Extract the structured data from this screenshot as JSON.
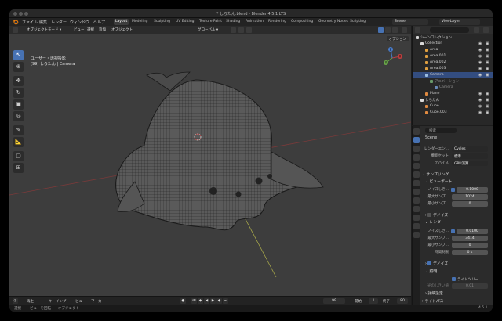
{
  "window": {
    "title": "* しろたん.blend - Blender 4.5.1 LTS"
  },
  "menubar": {
    "items": [
      "ファイル",
      "編集",
      "レンダー",
      "ウィンドウ",
      "ヘルプ"
    ],
    "workspaces": [
      "Layout",
      "Modeling",
      "Sculpting",
      "UV Editing",
      "Texture Paint",
      "Shading",
      "Animation",
      "Rendering",
      "Compositing",
      "Geometry Nodes",
      "Scripting"
    ],
    "active_workspace": "Layout",
    "scene": "Scene",
    "view_layer": "ViewLayer"
  },
  "viewport_header": {
    "mode": "オブジェクトモード",
    "menus": [
      "ビュー",
      "選択",
      "追加",
      "オブジェクト"
    ],
    "transform_orientation": "グローバル",
    "options": "オプション"
  },
  "viewport": {
    "view_name": "ユーザー・透視投影",
    "object_info": "(99) しろたん | Camera",
    "tools": [
      "select-icon",
      "cursor-icon",
      "move-icon",
      "rotate-icon",
      "scale-icon",
      "transform-icon",
      "annotate-icon",
      "measure-icon",
      "add-cube-icon",
      "camera-view-icon"
    ],
    "gizmo_labels": {
      "x": "X",
      "y": "Y",
      "z": "Z"
    }
  },
  "timeline": {
    "mode": "再生",
    "keying": "キーイング",
    "view": "ビュー",
    "marker": "マーカー",
    "current_frame": "99",
    "start_label": "開始",
    "start": "1",
    "end_label": "終了",
    "end": "80"
  },
  "statusbar": {
    "items": [
      "選択",
      "ビューを回転",
      "オブジェクト"
    ],
    "version": "4.5.1"
  },
  "outliner": {
    "rows": [
      {
        "label": "シーンコレクション",
        "depth": 0,
        "icon": "collection",
        "selected": false
      },
      {
        "label": "Collection",
        "depth": 1,
        "icon": "collection",
        "selected": false
      },
      {
        "label": "Area",
        "depth": 2,
        "icon": "light",
        "selected": false
      },
      {
        "label": "Area.001",
        "depth": 2,
        "icon": "light",
        "selected": false
      },
      {
        "label": "Area.002",
        "depth": 2,
        "icon": "light",
        "selected": false
      },
      {
        "label": "Area.003",
        "depth": 2,
        "icon": "light",
        "selected": false
      },
      {
        "label": "Camera",
        "depth": 2,
        "icon": "camera",
        "selected": true
      },
      {
        "label": "アニメーション",
        "depth": 3,
        "icon": "anim",
        "selected": false
      },
      {
        "label": "Camera",
        "depth": 4,
        "icon": "camera-data",
        "selected": false
      },
      {
        "label": "Plane",
        "depth": 2,
        "icon": "mesh",
        "selected": false
      },
      {
        "label": "しろたん",
        "depth": 1,
        "icon": "collection",
        "selected": false
      },
      {
        "label": "Cube",
        "depth": 2,
        "icon": "mesh",
        "selected": false
      },
      {
        "label": "Cube.003",
        "depth": 2,
        "icon": "mesh",
        "selected": false
      }
    ]
  },
  "properties": {
    "search_placeholder": "検索",
    "breadcrumb": "Scene",
    "render_engine_label": "レンダーエン...",
    "render_engine": "Cycles",
    "feature_set_label": "機能セット",
    "feature_set": "標準",
    "device_label": "デバイス",
    "device": "GPU演算",
    "sampling_section": "サンプリング",
    "viewport_section": "ビューポート",
    "noise_threshold_label": "ノイズしき...",
    "viewport_noise_threshold": "0.1000",
    "max_samples_label": "最大サンプ...",
    "viewport_max_samples": "1024",
    "min_samples_label": "最小サンプ...",
    "viewport_min_samples": "0",
    "denoise_section": "デノイズ",
    "render_section": "レンダー",
    "render_noise_threshold": "0.0100",
    "render_max_samples": "3414",
    "render_min_samples": "0",
    "time_limit_label": "時間制限",
    "time_limit": "0 s",
    "denoise_label": "デノイズ",
    "lights_section": "照明",
    "light_tree_label": "ライトツリー",
    "light_threshold_label": "光のしきい値",
    "light_threshold": "0.01",
    "advanced_section": "詳細設定",
    "light_paths_section": "ライトパス"
  }
}
